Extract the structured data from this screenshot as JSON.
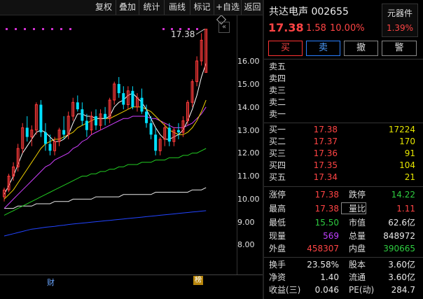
{
  "toolbar": {
    "items": [
      "复权",
      "叠加",
      "统计",
      "画线",
      "标记",
      "+自选",
      "返回"
    ]
  },
  "chart": {
    "price_labels": [
      "16.00",
      "15.00",
      "14.00",
      "13.00",
      "12.00",
      "11.00",
      "10.00",
      "9.00",
      "8.00"
    ],
    "high_label": "17.38",
    "fin_badge": "财",
    "list_badge": "榜",
    "colors": {
      "up": "#ff3a3a",
      "down": "#00e0ff",
      "ma5": "#ffffff",
      "ma10": "#f0d000",
      "ma20": "#d040ff",
      "ma60": "#22cc22",
      "ma120": "#e8e8e8",
      "ma250": "#2244ff"
    }
  },
  "chart_data": {
    "type": "candlestick",
    "title": "",
    "ylim": [
      7.6,
      17.8
    ],
    "candles": [
      {
        "o": 10.1,
        "h": 10.5,
        "l": 9.9,
        "c": 10.4
      },
      {
        "o": 10.4,
        "h": 11.1,
        "l": 10.3,
        "c": 11.0
      },
      {
        "o": 11.0,
        "h": 11.6,
        "l": 10.8,
        "c": 11.4
      },
      {
        "o": 11.4,
        "h": 12.4,
        "l": 11.2,
        "c": 12.2
      },
      {
        "o": 12.2,
        "h": 13.3,
        "l": 12.0,
        "c": 13.1
      },
      {
        "o": 13.1,
        "h": 13.6,
        "l": 12.5,
        "c": 12.7
      },
      {
        "o": 12.7,
        "h": 13.2,
        "l": 12.3,
        "c": 13.0
      },
      {
        "o": 13.0,
        "h": 14.2,
        "l": 12.8,
        "c": 14.1
      },
      {
        "o": 14.1,
        "h": 14.3,
        "l": 12.7,
        "c": 12.9
      },
      {
        "o": 12.9,
        "h": 13.3,
        "l": 12.1,
        "c": 12.4
      },
      {
        "o": 12.4,
        "h": 12.8,
        "l": 11.9,
        "c": 12.1
      },
      {
        "o": 12.1,
        "h": 12.7,
        "l": 11.9,
        "c": 12.5
      },
      {
        "o": 12.5,
        "h": 13.1,
        "l": 12.3,
        "c": 13.0
      },
      {
        "o": 13.0,
        "h": 13.6,
        "l": 12.6,
        "c": 12.8
      },
      {
        "o": 12.8,
        "h": 13.8,
        "l": 12.6,
        "c": 13.6
      },
      {
        "o": 13.6,
        "h": 14.4,
        "l": 13.4,
        "c": 14.2
      },
      {
        "o": 14.2,
        "h": 14.5,
        "l": 13.8,
        "c": 13.9
      },
      {
        "o": 13.9,
        "h": 14.2,
        "l": 13.2,
        "c": 13.4
      },
      {
        "o": 13.4,
        "h": 13.7,
        "l": 12.7,
        "c": 13.0
      },
      {
        "o": 13.0,
        "h": 13.8,
        "l": 12.8,
        "c": 13.6
      },
      {
        "o": 13.6,
        "h": 13.9,
        "l": 13.0,
        "c": 13.2
      },
      {
        "o": 13.2,
        "h": 13.9,
        "l": 13.0,
        "c": 13.7
      },
      {
        "o": 13.7,
        "h": 14.0,
        "l": 13.2,
        "c": 13.5
      },
      {
        "o": 13.5,
        "h": 14.4,
        "l": 13.3,
        "c": 14.3
      },
      {
        "o": 14.3,
        "h": 15.1,
        "l": 14.1,
        "c": 15.0
      },
      {
        "o": 15.0,
        "h": 15.3,
        "l": 14.4,
        "c": 14.6
      },
      {
        "o": 14.6,
        "h": 14.9,
        "l": 13.9,
        "c": 14.1
      },
      {
        "o": 14.1,
        "h": 14.9,
        "l": 13.9,
        "c": 14.7
      },
      {
        "o": 14.7,
        "h": 14.9,
        "l": 13.9,
        "c": 14.0
      },
      {
        "o": 14.0,
        "h": 14.6,
        "l": 13.8,
        "c": 14.4
      },
      {
        "o": 14.4,
        "h": 14.8,
        "l": 13.7,
        "c": 13.8
      },
      {
        "o": 13.8,
        "h": 14.1,
        "l": 13.1,
        "c": 13.3
      },
      {
        "o": 13.3,
        "h": 13.6,
        "l": 12.6,
        "c": 12.8
      },
      {
        "o": 12.8,
        "h": 13.1,
        "l": 11.9,
        "c": 12.1
      },
      {
        "o": 12.1,
        "h": 12.7,
        "l": 11.9,
        "c": 12.6
      },
      {
        "o": 12.6,
        "h": 13.3,
        "l": 12.3,
        "c": 13.1
      },
      {
        "o": 13.1,
        "h": 13.3,
        "l": 12.3,
        "c": 12.5
      },
      {
        "o": 12.5,
        "h": 13.1,
        "l": 12.3,
        "c": 13.0
      },
      {
        "o": 13.0,
        "h": 13.3,
        "l": 12.6,
        "c": 12.9
      },
      {
        "o": 12.9,
        "h": 13.6,
        "l": 12.7,
        "c": 13.4
      },
      {
        "o": 13.4,
        "h": 14.3,
        "l": 13.2,
        "c": 14.2
      },
      {
        "o": 14.2,
        "h": 15.2,
        "l": 14.0,
        "c": 15.1
      },
      {
        "o": 15.1,
        "h": 16.2,
        "l": 14.9,
        "c": 16.0
      },
      {
        "o": 16.0,
        "h": 17.2,
        "l": 15.8,
        "c": 16.9
      },
      {
        "o": 15.5,
        "h": 17.38,
        "l": 15.5,
        "c": 17.38
      }
    ],
    "ma5": [
      10.2,
      10.6,
      11.0,
      11.5,
      12.0,
      12.3,
      12.6,
      12.9,
      13.0,
      12.9,
      12.7,
      12.5,
      12.5,
      12.6,
      12.8,
      13.3,
      13.7,
      13.7,
      13.6,
      13.6,
      13.5,
      13.5,
      13.5,
      13.6,
      14.0,
      14.2,
      14.3,
      14.5,
      14.6,
      14.4,
      14.2,
      13.9,
      13.5,
      13.1,
      12.8,
      12.6,
      12.6,
      12.7,
      12.8,
      13.0,
      13.4,
      13.9,
      14.5,
      15.3,
      15.9
    ],
    "ma10": [
      10.0,
      10.2,
      10.4,
      10.7,
      11.0,
      11.3,
      11.6,
      11.9,
      12.2,
      12.4,
      12.5,
      12.6,
      12.6,
      12.7,
      12.8,
      12.9,
      13.1,
      13.2,
      13.3,
      13.4,
      13.5,
      13.5,
      13.5,
      13.5,
      13.6,
      13.7,
      13.8,
      13.9,
      14.0,
      14.0,
      14.0,
      13.9,
      13.8,
      13.6,
      13.4,
      13.2,
      13.0,
      12.9,
      12.8,
      12.8,
      12.9,
      13.1,
      13.4,
      13.8,
      14.3
    ],
    "ma20": [
      9.6,
      9.8,
      10.0,
      10.2,
      10.4,
      10.6,
      10.8,
      11.0,
      11.2,
      11.4,
      11.5,
      11.7,
      11.8,
      11.9,
      12.0,
      12.2,
      12.3,
      12.5,
      12.6,
      12.8,
      12.9,
      13.0,
      13.1,
      13.2,
      13.3,
      13.4,
      13.5,
      13.5,
      13.6,
      13.6,
      13.6,
      13.6,
      13.5,
      13.5,
      13.4,
      13.3,
      13.2,
      13.1,
      13.1,
      13.1,
      13.2,
      13.3,
      13.5,
      13.7,
      14.0
    ],
    "ma60": [
      9.3,
      9.4,
      9.5,
      9.6,
      9.7,
      9.8,
      9.9,
      10.0,
      10.1,
      10.2,
      10.3,
      10.4,
      10.5,
      10.6,
      10.7,
      10.8,
      10.9,
      11.0,
      11.0,
      11.1,
      11.1,
      11.2,
      11.2,
      11.3,
      11.3,
      11.4,
      11.4,
      11.5,
      11.5,
      11.5,
      11.6,
      11.6,
      11.6,
      11.7,
      11.7,
      11.7,
      11.8,
      11.8,
      11.8,
      11.9,
      11.9,
      12.0,
      12.0,
      12.1,
      12.2
    ],
    "ma120": [
      9.6,
      9.6,
      9.6,
      9.7,
      9.7,
      9.7,
      9.7,
      9.8,
      9.8,
      9.8,
      9.8,
      9.9,
      9.9,
      9.9,
      9.9,
      10.0,
      10.0,
      10.0,
      10.0,
      10.0,
      10.1,
      10.1,
      10.1,
      10.1,
      10.1,
      10.1,
      10.2,
      10.2,
      10.2,
      10.2,
      10.2,
      10.2,
      10.2,
      10.3,
      10.3,
      10.3,
      10.3,
      10.3,
      10.3,
      10.3,
      10.3,
      10.4,
      10.4,
      10.4,
      10.5
    ],
    "ma250": [
      8.4,
      8.45,
      8.5,
      8.55,
      8.6,
      8.65,
      8.7,
      8.72,
      8.75,
      8.78,
      8.8,
      8.82,
      8.85,
      8.87,
      8.9,
      8.92,
      8.94,
      8.96,
      8.98,
      9.0,
      9.02,
      9.04,
      9.06,
      9.08,
      9.1,
      9.12,
      9.14,
      9.16,
      9.18,
      9.2,
      9.22,
      9.24,
      9.26,
      9.28,
      9.3,
      9.32,
      9.34,
      9.36,
      9.38,
      9.4,
      9.42,
      9.44,
      9.46,
      9.48,
      9.5
    ]
  },
  "panel": {
    "stock_name": "共达电声 002655",
    "sector_name": "元器件",
    "sector_change": "1.39%",
    "price": "17.38",
    "change": "1.58",
    "change_pct": "10.00%",
    "buttons": {
      "buy": "买",
      "sell": "卖",
      "cancel": "撤",
      "alert": "警"
    },
    "sell_levels": [
      "卖五",
      "卖四",
      "卖三",
      "卖二",
      "卖一"
    ],
    "buy_levels": [
      {
        "label": "买一",
        "price": "17.38",
        "volume": "17224"
      },
      {
        "label": "买二",
        "price": "17.37",
        "volume": "170"
      },
      {
        "label": "买三",
        "price": "17.36",
        "volume": "91"
      },
      {
        "label": "买四",
        "price": "17.35",
        "volume": "104"
      },
      {
        "label": "买五",
        "price": "17.34",
        "volume": "21"
      }
    ],
    "quotes": [
      {
        "l1": "涨停",
        "v1": "17.38",
        "l2": "跌停",
        "v2": "14.22"
      },
      {
        "l1": "最高",
        "v1": "17.38",
        "l2": "量比",
        "v2": "1.11"
      },
      {
        "l1": "最低",
        "v1": "15.50",
        "l2": "市值",
        "v2": "62.6亿"
      },
      {
        "l1": "现量",
        "v1": "569",
        "l2": "总量",
        "v2": "848972"
      },
      {
        "l1": "外盘",
        "v1": "458307",
        "l2": "内盘",
        "v2": "390665"
      },
      {
        "l1": "换手",
        "v1": "23.58%",
        "l2": "股本",
        "v2": "3.60亿"
      },
      {
        "l1": "净资",
        "v1": "1.40",
        "l2": "流通",
        "v2": "3.60亿"
      },
      {
        "l1": "收益(三)",
        "v1": "0.046",
        "l2": "PE(动)",
        "v2": "284.7"
      }
    ]
  }
}
